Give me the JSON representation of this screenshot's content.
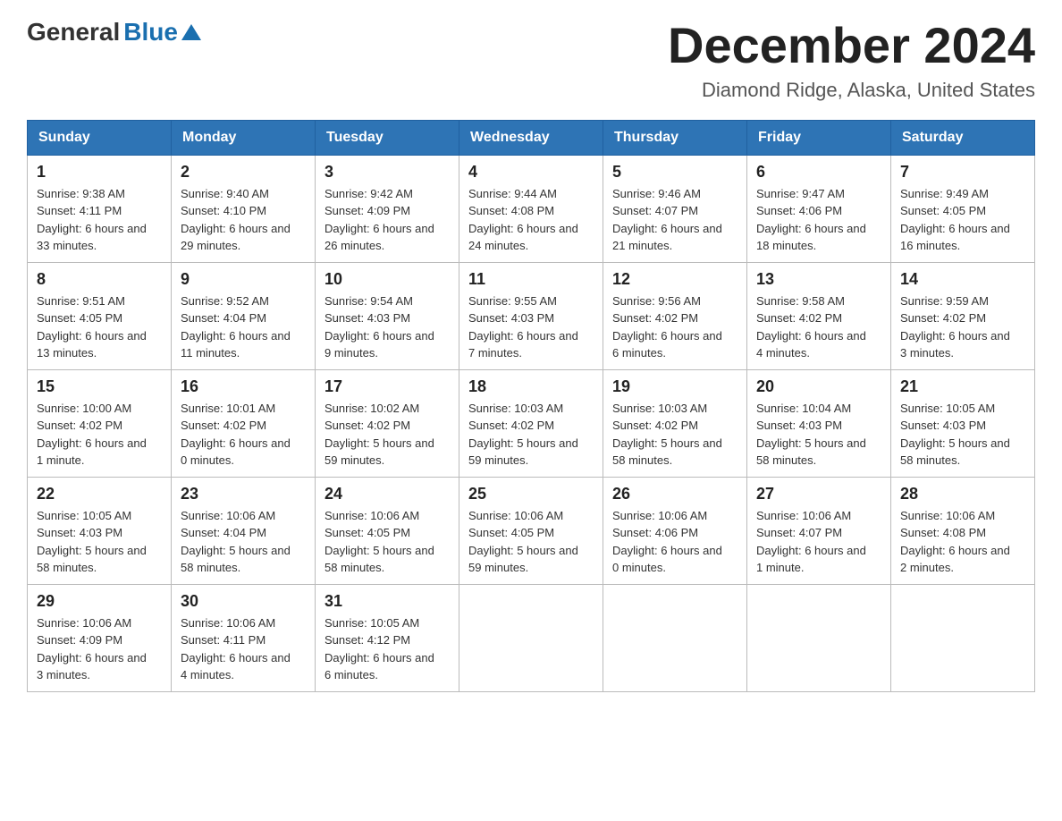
{
  "header": {
    "logo_general": "General",
    "logo_blue": "Blue",
    "title": "December 2024",
    "subtitle": "Diamond Ridge, Alaska, United States"
  },
  "weekdays": [
    "Sunday",
    "Monday",
    "Tuesday",
    "Wednesday",
    "Thursday",
    "Friday",
    "Saturday"
  ],
  "weeks": [
    [
      {
        "day": "1",
        "sunrise": "9:38 AM",
        "sunset": "4:11 PM",
        "daylight": "6 hours and 33 minutes."
      },
      {
        "day": "2",
        "sunrise": "9:40 AM",
        "sunset": "4:10 PM",
        "daylight": "6 hours and 29 minutes."
      },
      {
        "day": "3",
        "sunrise": "9:42 AM",
        "sunset": "4:09 PM",
        "daylight": "6 hours and 26 minutes."
      },
      {
        "day": "4",
        "sunrise": "9:44 AM",
        "sunset": "4:08 PM",
        "daylight": "6 hours and 24 minutes."
      },
      {
        "day": "5",
        "sunrise": "9:46 AM",
        "sunset": "4:07 PM",
        "daylight": "6 hours and 21 minutes."
      },
      {
        "day": "6",
        "sunrise": "9:47 AM",
        "sunset": "4:06 PM",
        "daylight": "6 hours and 18 minutes."
      },
      {
        "day": "7",
        "sunrise": "9:49 AM",
        "sunset": "4:05 PM",
        "daylight": "6 hours and 16 minutes."
      }
    ],
    [
      {
        "day": "8",
        "sunrise": "9:51 AM",
        "sunset": "4:05 PM",
        "daylight": "6 hours and 13 minutes."
      },
      {
        "day": "9",
        "sunrise": "9:52 AM",
        "sunset": "4:04 PM",
        "daylight": "6 hours and 11 minutes."
      },
      {
        "day": "10",
        "sunrise": "9:54 AM",
        "sunset": "4:03 PM",
        "daylight": "6 hours and 9 minutes."
      },
      {
        "day": "11",
        "sunrise": "9:55 AM",
        "sunset": "4:03 PM",
        "daylight": "6 hours and 7 minutes."
      },
      {
        "day": "12",
        "sunrise": "9:56 AM",
        "sunset": "4:02 PM",
        "daylight": "6 hours and 6 minutes."
      },
      {
        "day": "13",
        "sunrise": "9:58 AM",
        "sunset": "4:02 PM",
        "daylight": "6 hours and 4 minutes."
      },
      {
        "day": "14",
        "sunrise": "9:59 AM",
        "sunset": "4:02 PM",
        "daylight": "6 hours and 3 minutes."
      }
    ],
    [
      {
        "day": "15",
        "sunrise": "10:00 AM",
        "sunset": "4:02 PM",
        "daylight": "6 hours and 1 minute."
      },
      {
        "day": "16",
        "sunrise": "10:01 AM",
        "sunset": "4:02 PM",
        "daylight": "6 hours and 0 minutes."
      },
      {
        "day": "17",
        "sunrise": "10:02 AM",
        "sunset": "4:02 PM",
        "daylight": "5 hours and 59 minutes."
      },
      {
        "day": "18",
        "sunrise": "10:03 AM",
        "sunset": "4:02 PM",
        "daylight": "5 hours and 59 minutes."
      },
      {
        "day": "19",
        "sunrise": "10:03 AM",
        "sunset": "4:02 PM",
        "daylight": "5 hours and 58 minutes."
      },
      {
        "day": "20",
        "sunrise": "10:04 AM",
        "sunset": "4:03 PM",
        "daylight": "5 hours and 58 minutes."
      },
      {
        "day": "21",
        "sunrise": "10:05 AM",
        "sunset": "4:03 PM",
        "daylight": "5 hours and 58 minutes."
      }
    ],
    [
      {
        "day": "22",
        "sunrise": "10:05 AM",
        "sunset": "4:03 PM",
        "daylight": "5 hours and 58 minutes."
      },
      {
        "day": "23",
        "sunrise": "10:06 AM",
        "sunset": "4:04 PM",
        "daylight": "5 hours and 58 minutes."
      },
      {
        "day": "24",
        "sunrise": "10:06 AM",
        "sunset": "4:05 PM",
        "daylight": "5 hours and 58 minutes."
      },
      {
        "day": "25",
        "sunrise": "10:06 AM",
        "sunset": "4:05 PM",
        "daylight": "5 hours and 59 minutes."
      },
      {
        "day": "26",
        "sunrise": "10:06 AM",
        "sunset": "4:06 PM",
        "daylight": "6 hours and 0 minutes."
      },
      {
        "day": "27",
        "sunrise": "10:06 AM",
        "sunset": "4:07 PM",
        "daylight": "6 hours and 1 minute."
      },
      {
        "day": "28",
        "sunrise": "10:06 AM",
        "sunset": "4:08 PM",
        "daylight": "6 hours and 2 minutes."
      }
    ],
    [
      {
        "day": "29",
        "sunrise": "10:06 AM",
        "sunset": "4:09 PM",
        "daylight": "6 hours and 3 minutes."
      },
      {
        "day": "30",
        "sunrise": "10:06 AM",
        "sunset": "4:11 PM",
        "daylight": "6 hours and 4 minutes."
      },
      {
        "day": "31",
        "sunrise": "10:05 AM",
        "sunset": "4:12 PM",
        "daylight": "6 hours and 6 minutes."
      },
      null,
      null,
      null,
      null
    ]
  ],
  "labels": {
    "sunrise": "Sunrise:",
    "sunset": "Sunset:",
    "daylight": "Daylight:"
  }
}
